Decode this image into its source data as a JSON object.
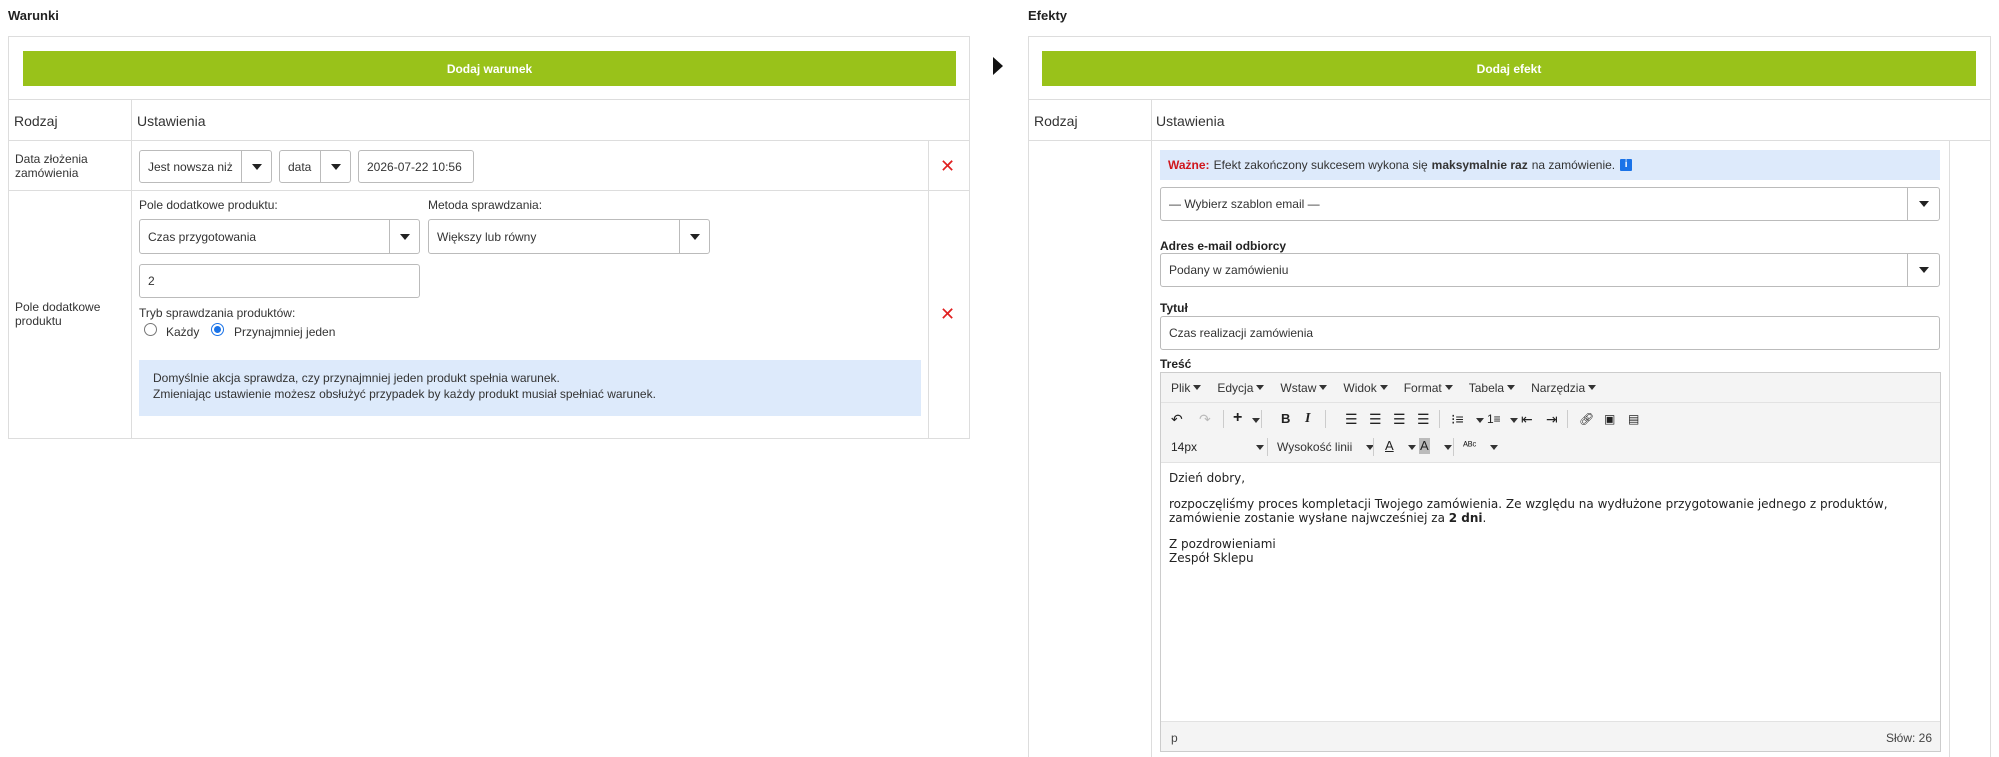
{
  "conditions": {
    "title": "Warunki",
    "add_button": "Dodaj warunek",
    "col_type": "Rodzaj",
    "col_settings": "Ustawienia",
    "rows": [
      {
        "label": "Data złożenia zamówienia",
        "operator": "Jest nowsza niż",
        "unit": "data",
        "value": "2026-07-22 10:56"
      },
      {
        "label": "Pole dodatkowe produktu",
        "field_label": "Pole dodatkowe produktu:",
        "field_value": "Czas przygotowania",
        "method_label": "Metoda sprawdzania:",
        "method_value": "Większy lub równy",
        "value": "2",
        "mode_label": "Tryb sprawdzania produktów:",
        "mode_every": "Każdy",
        "mode_any": "Przynajmniej jeden",
        "info_line1": "Domyślnie akcja sprawdza, czy przynajmniej jeden produkt spełnia warunek.",
        "info_line2": "Zmieniając ustawienie możesz obsłużyć przypadek by każdy produkt musiał spełniać warunek."
      }
    ]
  },
  "effects": {
    "title": "Efekty",
    "add_button": "Dodaj efekt",
    "col_type": "Rodzaj",
    "col_settings": "Ustawienia",
    "notice_warn": "Ważne:",
    "notice_text1": "Efekt zakończony sukcesem wykona się",
    "notice_bold": "maksymalnie raz",
    "notice_text2": "na zamówienie.",
    "notice_icon": "i",
    "template_select": "— Wybierz szablon email —",
    "recipient_label": "Adres e-mail odbiorcy",
    "recipient_value": "Podany w zamówieniu",
    "subject_label": "Tytuł",
    "subject_value": "Czas realizacji zamówienia",
    "body_label": "Treść",
    "editor": {
      "menu": [
        "Plik",
        "Edycja",
        "Wstaw",
        "Widok",
        "Format",
        "Tabela",
        "Narzędzia"
      ],
      "font_size": "14px",
      "line_height_label": "Wysokość linii",
      "content": {
        "greeting": "Dzień dobry,",
        "para1_a": "rozpoczęliśmy proces kompletacji Twojego zamówienia. Ze względu na wydłużone przygotowanie jednego z produktów,",
        "para1_b": "zamówienie zostanie wysłane najwcześniej za",
        "para1_bold": "2 dni",
        "para1_end": ".",
        "closing1": "Z pozdrowieniami",
        "closing2": "Zespół Sklepu"
      },
      "status_path": "p",
      "word_count": "Słów: 26"
    }
  },
  "colors": {
    "accent_green": "#99c21a",
    "danger_red": "#e02020",
    "info_blue_bg": "#ddeafb",
    "radio_blue": "#1a73e8"
  }
}
